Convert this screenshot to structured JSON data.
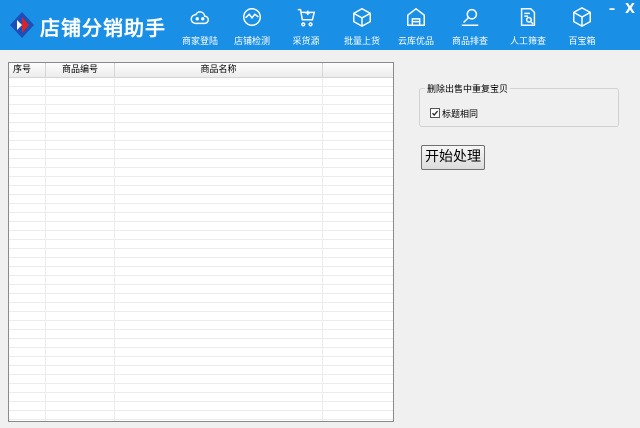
{
  "app": {
    "title": "店铺分销助手"
  },
  "nav": [
    {
      "label": "商家登陆",
      "icon": "cloud-icon"
    },
    {
      "label": "店铺检测",
      "icon": "chart-wave-icon"
    },
    {
      "label": "采货源",
      "icon": "cart-plus-icon"
    },
    {
      "label": "批量上货",
      "icon": "box-arrow-icon"
    },
    {
      "label": "云库优品",
      "icon": "warehouse-icon"
    },
    {
      "label": "商品排查",
      "icon": "search-list-icon"
    },
    {
      "label": "人工筛查",
      "icon": "document-search-icon"
    },
    {
      "label": "百宝箱",
      "icon": "cube-icon"
    }
  ],
  "window": {
    "minimize": "–",
    "close": "X"
  },
  "table": {
    "columns": [
      "序号",
      "商品编号",
      "商品名称"
    ]
  },
  "options": {
    "group_title": "删除出售中重复宝贝",
    "checkbox_label": "标题相同",
    "checkbox_checked": true
  },
  "actions": {
    "start_label": "开始处理"
  },
  "colors": {
    "header_bg": "#1a8fe6",
    "logo_blue": "#1d4fb8",
    "logo_red": "#d8232a"
  }
}
